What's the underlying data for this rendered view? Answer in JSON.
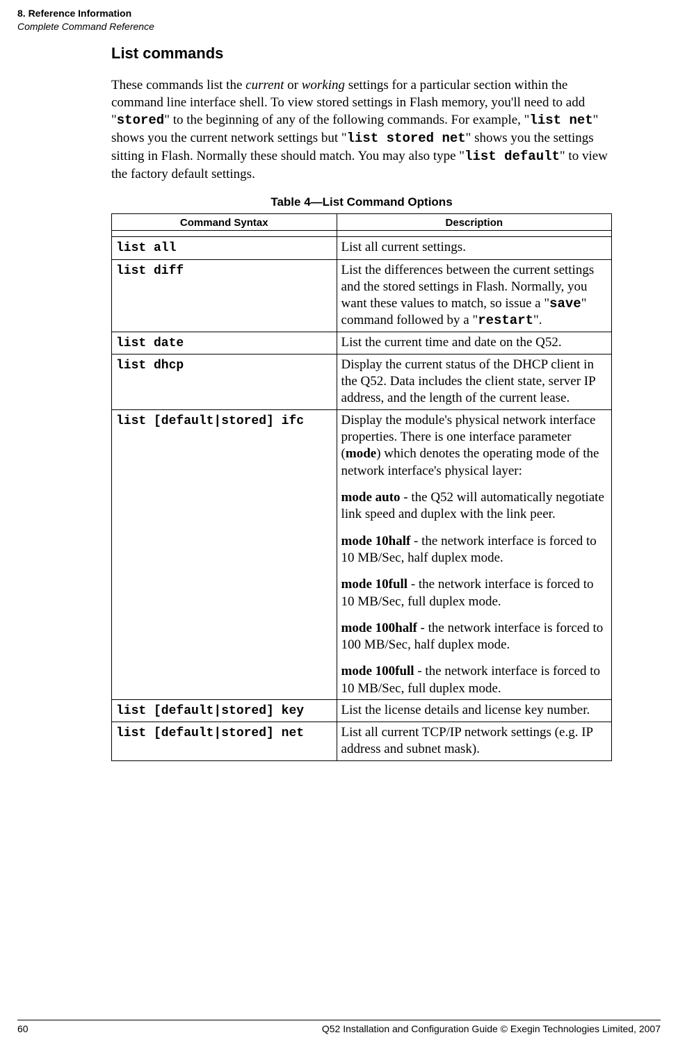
{
  "header": {
    "chapter": "8. Reference Information",
    "section": "Complete Command Reference"
  },
  "main": {
    "title": "List commands",
    "intro_pre": "These commands list the ",
    "intro_em1": "current",
    "intro_mid1": " or ",
    "intro_em2": "working",
    "intro_mid2": " settings for a particular section within the command line interface shell. To view stored settings in Flash memory, you'll need to add \"",
    "intro_code1": "stored",
    "intro_mid3": "\" to the beginning of any of the following commands. For example, \"",
    "intro_code2": "list net",
    "intro_mid4": "\" shows you the current network settings but \"",
    "intro_code3": "list stored net",
    "intro_mid5": "\" shows you the settings sitting in Flash. Normally these should match. You may also type \"",
    "intro_code4": "list default",
    "intro_mid6": "\" to view the factory default settings.",
    "table_caption": "Table 4—List Command Options",
    "th_syntax": "Command Syntax",
    "th_desc": "Description",
    "rows": [
      {
        "cmd": "list all",
        "desc_plain": "List all current settings."
      },
      {
        "cmd": "list diff",
        "desc_pre": "List the differences between the current settings and the stored settings in Flash. Normally, you want these values to match, so issue a \"",
        "code1": "save",
        "mid1": "\" command followed by a \"",
        "code2": "restart",
        "post": "\"."
      },
      {
        "cmd": "list date",
        "desc_plain": "List the current time and date on the Q52."
      },
      {
        "cmd": "list dhcp",
        "desc_plain": "Display the current status of the DHCP client in the Q52. Data includes the client state, server IP address, and the length of the current lease."
      },
      {
        "cmd": "list [default|stored] ifc",
        "p1_pre": "Display the module's physical network interface properties. There is one interface parameter (",
        "p1_b": "mode",
        "p1_post": ") which denotes the operating mode of the network interface's physical layer:",
        "p2_b": "mode auto",
        "p2_post": " - the Q52 will automatically negotiate link speed and duplex with the link peer.",
        "p3_b": "mode 10half",
        "p3_post": " - the network interface is forced to 10 MB/Sec, half duplex mode.",
        "p4_b": "mode 10full",
        "p4_post": " - the network interface is forced to 10 MB/Sec, full duplex mode.",
        "p5_b": "mode 100half",
        "p5_post": " - the network interface is forced to 100 MB/Sec, half duplex mode.",
        "p6_b": "mode 100full",
        "p6_post": " - the network interface is forced to 10 MB/Sec, full duplex mode."
      },
      {
        "cmd": "list [default|stored] key",
        "desc_plain": "List the license details and license key number."
      },
      {
        "cmd": "list [default|stored] net",
        "desc_plain": "List all current TCP/IP network settings (e.g. IP address and subnet mask)."
      }
    ]
  },
  "footer": {
    "page": "60",
    "right": "Q52 Installation and Configuration Guide  © Exegin Technologies Limited, 2007"
  }
}
